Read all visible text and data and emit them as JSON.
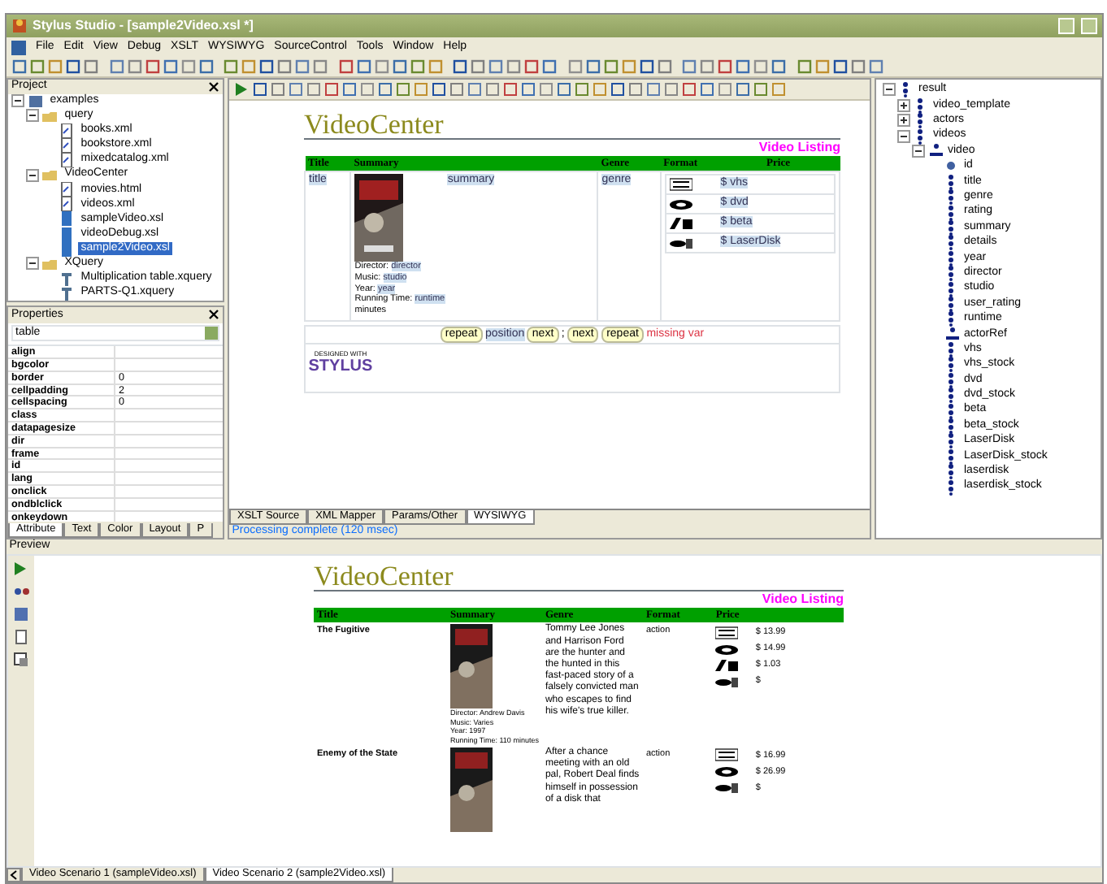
{
  "window": {
    "title": "Stylus Studio - [sample2Video.xsl *]"
  },
  "menu": [
    "File",
    "Edit",
    "View",
    "Debug",
    "XSLT",
    "WYSIWYG",
    "SourceControl",
    "Tools",
    "Window",
    "Help"
  ],
  "project": {
    "title": "Project",
    "tree": [
      {
        "label": "examples",
        "kind": "project",
        "expanded": true,
        "selected": false,
        "children": [
          {
            "label": "query",
            "kind": "folder",
            "expanded": true,
            "selected": false,
            "children": [
              {
                "label": "books.xml",
                "kind": "xml",
                "selected": false
              },
              {
                "label": "bookstore.xml",
                "kind": "xml",
                "selected": false
              },
              {
                "label": "mixedcatalog.xml",
                "kind": "xml",
                "selected": false
              }
            ]
          },
          {
            "label": "VideoCenter",
            "kind": "folder",
            "expanded": true,
            "selected": false,
            "children": [
              {
                "label": "movies.html",
                "kind": "xml",
                "selected": false
              },
              {
                "label": "videos.xml",
                "kind": "xml",
                "selected": false
              },
              {
                "label": "sampleVideo.xsl",
                "kind": "xsl",
                "selected": false
              },
              {
                "label": "videoDebug.xsl",
                "kind": "xsl",
                "selected": false
              },
              {
                "label": "sample2Video.xsl",
                "kind": "xsl",
                "selected": true
              }
            ]
          },
          {
            "label": "XQuery",
            "kind": "folder",
            "expanded": true,
            "selected": false,
            "children": [
              {
                "label": "Multiplication table.xquery",
                "kind": "xquery",
                "selected": false
              },
              {
                "label": "PARTS-Q1.xquery",
                "kind": "xquery",
                "selected": false
              }
            ]
          }
        ]
      }
    ]
  },
  "properties": {
    "title": "Properties",
    "element": "table",
    "rows": [
      {
        "name": "align"
      },
      {
        "name": "bgcolor"
      },
      {
        "name": "border",
        "value": "0"
      },
      {
        "name": "cellpadding",
        "value": "2"
      },
      {
        "name": "cellspacing",
        "value": "0"
      },
      {
        "name": "class"
      },
      {
        "name": "datapagesize"
      },
      {
        "name": "dir"
      },
      {
        "name": "frame"
      },
      {
        "name": "id"
      },
      {
        "name": "lang"
      },
      {
        "name": "onclick"
      },
      {
        "name": "ondblclick"
      },
      {
        "name": "onkeydown"
      }
    ],
    "tabs": [
      {
        "label": "Attribute",
        "selected": true
      },
      {
        "label": "Text",
        "selected": false
      },
      {
        "label": "Color",
        "selected": false
      },
      {
        "label": "Layout",
        "selected": false
      },
      {
        "label": "P",
        "selected": false
      }
    ]
  },
  "designer": {
    "heading": "VideoCenter",
    "subheading": "Video Listing",
    "columns": [
      "Title",
      "Summary",
      "Genre",
      "Format",
      "Price"
    ],
    "title_cell": "title",
    "summary_cell": "summary",
    "genre_cell": "genre",
    "details": [
      {
        "label": "Director:",
        "value": "director"
      },
      {
        "label": "Music:",
        "value": "studio"
      },
      {
        "label": "Year:",
        "value": "year"
      },
      {
        "label": "Running Time:",
        "value": "runtime"
      },
      {
        "label": "minutes"
      }
    ],
    "formats": [
      {
        "kind": "vhs",
        "price": "$ vhs"
      },
      {
        "kind": "dvd",
        "price": "$ dvd"
      },
      {
        "kind": "beta",
        "price": "$ beta"
      },
      {
        "kind": "laserdisc",
        "price": "$ LaserDisk"
      }
    ],
    "footer": [
      {
        "text": "repeat",
        "kind": "tag"
      },
      {
        "text": "position",
        "kind": "value"
      },
      {
        "text": "next",
        "kind": "tag"
      },
      {
        "text": ";",
        "kind": "plain"
      },
      {
        "text": "next",
        "kind": "tag"
      },
      {
        "text": "repeat",
        "kind": "tag"
      },
      {
        "text": "missing var",
        "kind": "error"
      }
    ],
    "logo": {
      "small": "DESIGNED WITH",
      "big": "STYLUS"
    },
    "tabs": [
      {
        "label": "XSLT Source",
        "selected": false
      },
      {
        "label": "XML Mapper",
        "selected": false
      },
      {
        "label": "Params/Other",
        "selected": false
      },
      {
        "label": "WYSIWYG",
        "selected": true
      }
    ]
  },
  "status": "Processing complete  (120 msec)",
  "schema_tree": [
    {
      "label": "result",
      "kind": "element",
      "expanded": true,
      "children": [
        {
          "label": "video_template",
          "kind": "element",
          "expanded": false
        },
        {
          "label": "actors",
          "kind": "element",
          "expanded": false
        },
        {
          "label": "videos",
          "kind": "element",
          "expanded": true,
          "children": [
            {
              "label": "video",
              "kind": "repeat",
              "expanded": true,
              "children": [
                {
                  "label": "id",
                  "kind": "attribute"
                },
                {
                  "label": "title",
                  "kind": "element"
                },
                {
                  "label": "genre",
                  "kind": "element"
                },
                {
                  "label": "rating",
                  "kind": "element"
                },
                {
                  "label": "summary",
                  "kind": "element"
                },
                {
                  "label": "details",
                  "kind": "element"
                },
                {
                  "label": "year",
                  "kind": "element"
                },
                {
                  "label": "director",
                  "kind": "element"
                },
                {
                  "label": "studio",
                  "kind": "element"
                },
                {
                  "label": "user_rating",
                  "kind": "element"
                },
                {
                  "label": "runtime",
                  "kind": "element"
                },
                {
                  "label": "actorRef",
                  "kind": "repeat"
                },
                {
                  "label": "vhs",
                  "kind": "element"
                },
                {
                  "label": "vhs_stock",
                  "kind": "element"
                },
                {
                  "label": "dvd",
                  "kind": "element"
                },
                {
                  "label": "dvd_stock",
                  "kind": "element"
                },
                {
                  "label": "beta",
                  "kind": "element"
                },
                {
                  "label": "beta_stock",
                  "kind": "element"
                },
                {
                  "label": "LaserDisk",
                  "kind": "element"
                },
                {
                  "label": "LaserDisk_stock",
                  "kind": "element"
                },
                {
                  "label": "laserdisk",
                  "kind": "element"
                },
                {
                  "label": "laserdisk_stock",
                  "kind": "element"
                }
              ]
            }
          ]
        }
      ]
    }
  ],
  "preview": {
    "title": "Preview",
    "heading": "VideoCenter",
    "subheading": "Video Listing",
    "columns": [
      "Title",
      "Summary",
      "Genre",
      "Format",
      "Price"
    ],
    "rows": [
      {
        "title": "The Fugitive",
        "summary": "Tommy Lee Jones and Harrison Ford are the hunter and the hunted in this fast-paced story of a falsely convicted man who escapes to find his wife's true killer.",
        "genre": "action",
        "details": [
          "Director: Andrew Davis",
          "Music: Varies",
          "Year: 1997",
          "Running Time: 110 minutes"
        ],
        "formats": [
          {
            "kind": "vhs",
            "price": "$ 13.99"
          },
          {
            "kind": "dvd",
            "price": "$ 14.99"
          },
          {
            "kind": "beta",
            "price": "$ 1.03"
          },
          {
            "kind": "laserdisc",
            "price": "$"
          }
        ]
      },
      {
        "title": "Enemy of the State",
        "summary": "After a chance meeting with an old pal, Robert Deal finds himself in possession of a disk that",
        "genre": "action",
        "details": [],
        "formats": [
          {
            "kind": "vhs",
            "price": "$ 16.99"
          },
          {
            "kind": "dvd",
            "price": "$ 26.99"
          },
          {
            "kind": "laserdisc",
            "price": "$"
          }
        ]
      }
    ]
  },
  "document_tabs": [
    {
      "label": "Video Scenario 1 (sampleVideo.xsl)",
      "selected": false
    },
    {
      "label": "Video Scenario 2 (sample2Video.xsl)",
      "selected": true
    }
  ]
}
